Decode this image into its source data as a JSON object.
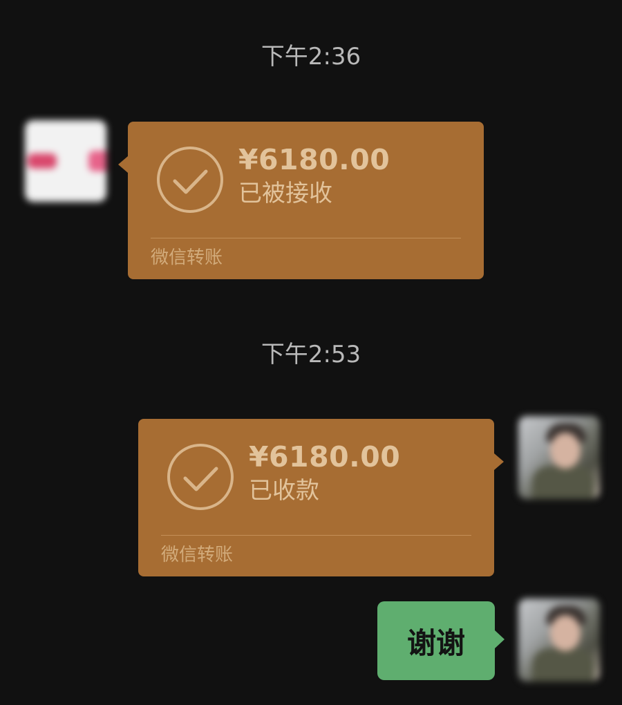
{
  "messages": [
    {
      "timestamp": "下午2:36",
      "transfer": {
        "amount": "¥6180.00",
        "status": "已被接收",
        "label": "微信转账"
      }
    },
    {
      "timestamp": "下午2:53",
      "transfer": {
        "amount": "¥6180.00",
        "status": "已收款",
        "label": "微信转账"
      },
      "text_reply": "谢谢"
    }
  ],
  "colors": {
    "background": "#111111",
    "transfer_bubble": "#a76d33",
    "transfer_text": "#e2c39b",
    "text_bubble": "#5fae6f",
    "timestamp_text": "#b9b9b9"
  },
  "icons": {
    "transfer_check": "checkmark-circle-icon"
  }
}
